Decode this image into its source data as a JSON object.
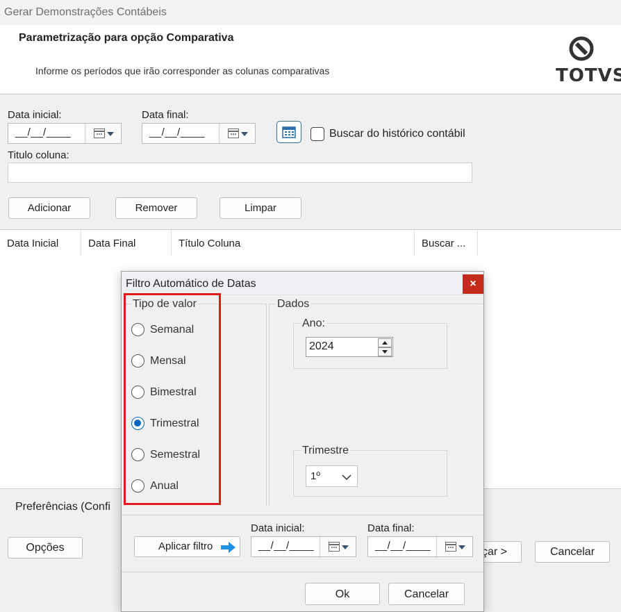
{
  "window": {
    "title": "Gerar Demonstrações Contábeis"
  },
  "header": {
    "title": "Parametrização para opção Comparativa",
    "subtitle": "Informe os períodos que irão corresponder as colunas comparativas",
    "logo_text": "TOTVS"
  },
  "form": {
    "start_label": "Data inicial:",
    "start_value": "__/__/____",
    "end_label": "Data final:",
    "end_value": "__/__/____",
    "history_label": "Buscar do histórico contábil",
    "column_title_label": "Titulo coluna:",
    "column_title_value": "",
    "add_button": "Adicionar",
    "remove_button": "Remover",
    "clear_button": "Limpar"
  },
  "table": {
    "columns": [
      "Data Inicial",
      "Data Final",
      "Título Coluna",
      "Buscar ..."
    ]
  },
  "footer": {
    "preferences_label": "Preferências  (Confi",
    "options_button": "Opções",
    "next_button_partial": "çar >",
    "cancel_button": "Cancelar"
  },
  "dialog": {
    "title": "Filtro Automático de Datas",
    "close_label": "×",
    "value_type_label": "Tipo de valor",
    "options": [
      "Semanal",
      "Mensal",
      "Bimestral",
      "Trimestral",
      "Semestral",
      "Anual"
    ],
    "selected_option": "Trimestral",
    "data_group_label": "Dados",
    "year_label": "Ano:",
    "year_value": "2024",
    "quarter_label": "Trimestre",
    "quarter_value": "1º",
    "apply_button": "Aplicar filtro",
    "start_label": "Data inicial:",
    "start_value": "__/__/____",
    "end_label": "Data final:",
    "end_value": "__/__/____",
    "ok_button": "Ok",
    "cancel_button": "Cancelar"
  },
  "colors": {
    "accent": "#0067c0",
    "close_red": "#c42b1c",
    "highlight_red": "#e0191b"
  }
}
